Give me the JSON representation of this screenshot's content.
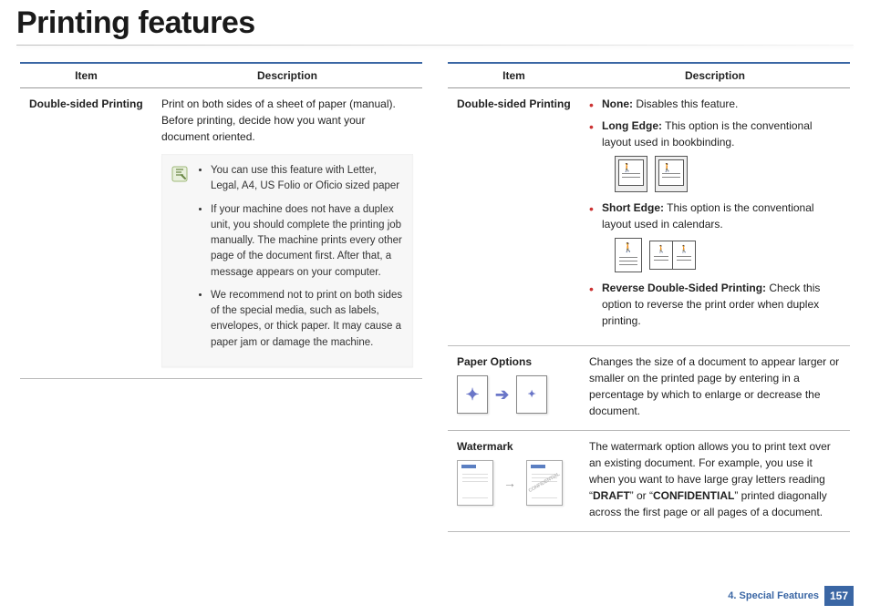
{
  "title": "Printing features",
  "left": {
    "headers": {
      "item": "Item",
      "desc": "Description"
    },
    "row": {
      "item": "Double-sided Printing",
      "desc": "Print on both sides of a sheet of paper (manual). Before printing, decide how you want your document oriented.",
      "notes": [
        "You can use this feature with Letter, Legal, A4, US Folio or Oficio sized paper",
        "If your machine does not have a duplex unit, you should complete the printing job manually. The machine prints every other page of the document first. After that, a message appears on your computer.",
        "We recommend not to print on both sides of the special media, such as labels, envelopes, or thick paper. It may cause a paper jam or damage the machine."
      ]
    }
  },
  "right": {
    "headers": {
      "item": "Item",
      "desc": "Description"
    },
    "duplex": {
      "item": "Double-sided Printing",
      "none_label": "None:",
      "none_text": " Disables this feature.",
      "long_label": "Long Edge:",
      "long_text": " This option is the conventional layout used in bookbinding.",
      "short_label": "Short Edge:",
      "short_text": " This option is the conventional layout used in calendars.",
      "rev_label": "Reverse Double-Sided Printing:",
      "rev_text": " Check this option to reverse the print order when duplex printing."
    },
    "paper": {
      "item": "Paper Options",
      "desc": "Changes the size of a document to appear larger or smaller on the printed page by entering in a percentage by which to enlarge or decrease the document."
    },
    "watermark": {
      "item": "Watermark",
      "pre": "The watermark option allows you to print text over an existing document. For example, you use it when you want to have large gray letters reading “",
      "draft": "DRAFT",
      "mid": "” or “",
      "conf": "CONFIDENTIAL",
      "post": "” printed diagonally across the first page or all pages of a document.",
      "thumb_label": "CONFIDENTIAL"
    }
  },
  "footer": {
    "section": "4.  Special Features",
    "page": "157"
  }
}
